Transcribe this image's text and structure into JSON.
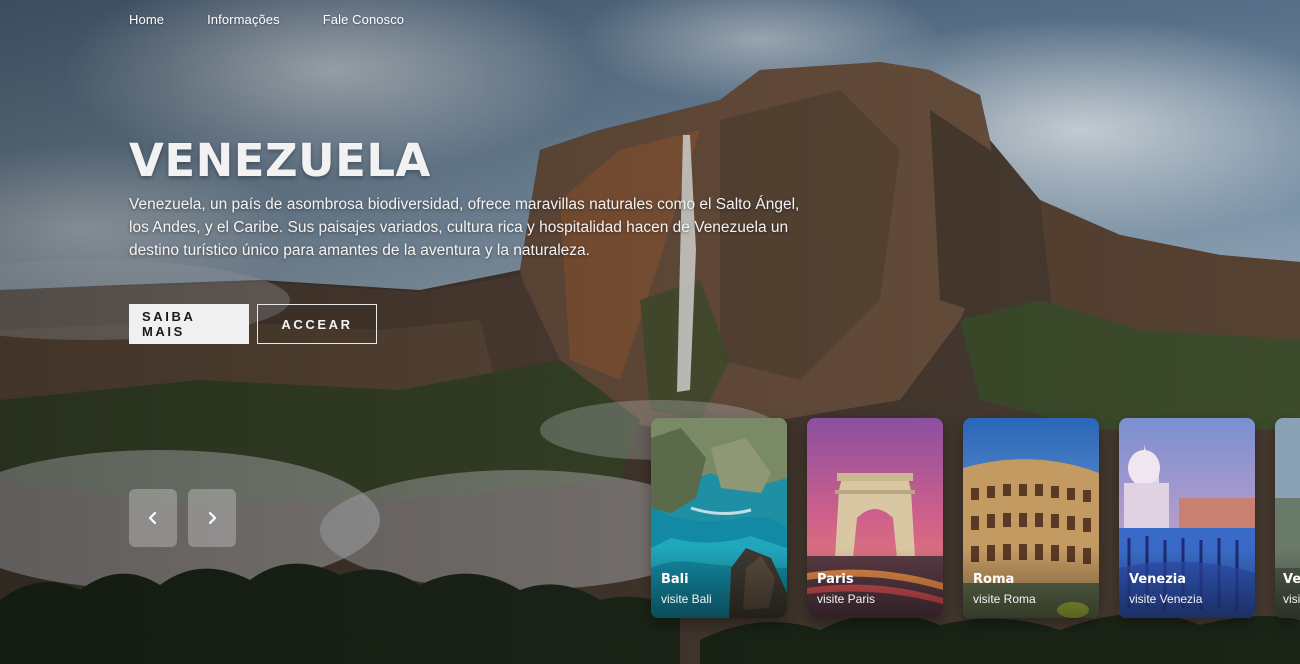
{
  "nav": {
    "items": [
      {
        "label": "Home"
      },
      {
        "label": "Informações"
      },
      {
        "label": "Fale Conosco"
      }
    ]
  },
  "hero": {
    "title": "VENEZUELA",
    "description": "Venezuela, un país de asombrosa biodiversidad, ofrece maravillas naturales como el Salto Ángel, los Andes, y el Caribe. Sus paisajes variados, cultura rica y hospitalidad hacen de Venezuela un destino turístico único para amantes de la aventura y la naturaleza.",
    "primary_button": "SAIBA MAIS",
    "secondary_button": "ACCEAR"
  },
  "slider": {
    "prev_icon": "chevron-left-icon",
    "next_icon": "chevron-right-icon"
  },
  "cards": [
    {
      "title": "Bali",
      "subtitle": "visite Bali"
    },
    {
      "title": "Paris",
      "subtitle": "visite Paris"
    },
    {
      "title": "Roma",
      "subtitle": "visite Roma"
    },
    {
      "title": "Venezia",
      "subtitle": "visite Venezia"
    },
    {
      "title": "Ve",
      "subtitle": "visi"
    }
  ],
  "colors": {
    "button_primary_bg": "#f0f0f0",
    "arrow_bg": "#c8c8c8"
  }
}
